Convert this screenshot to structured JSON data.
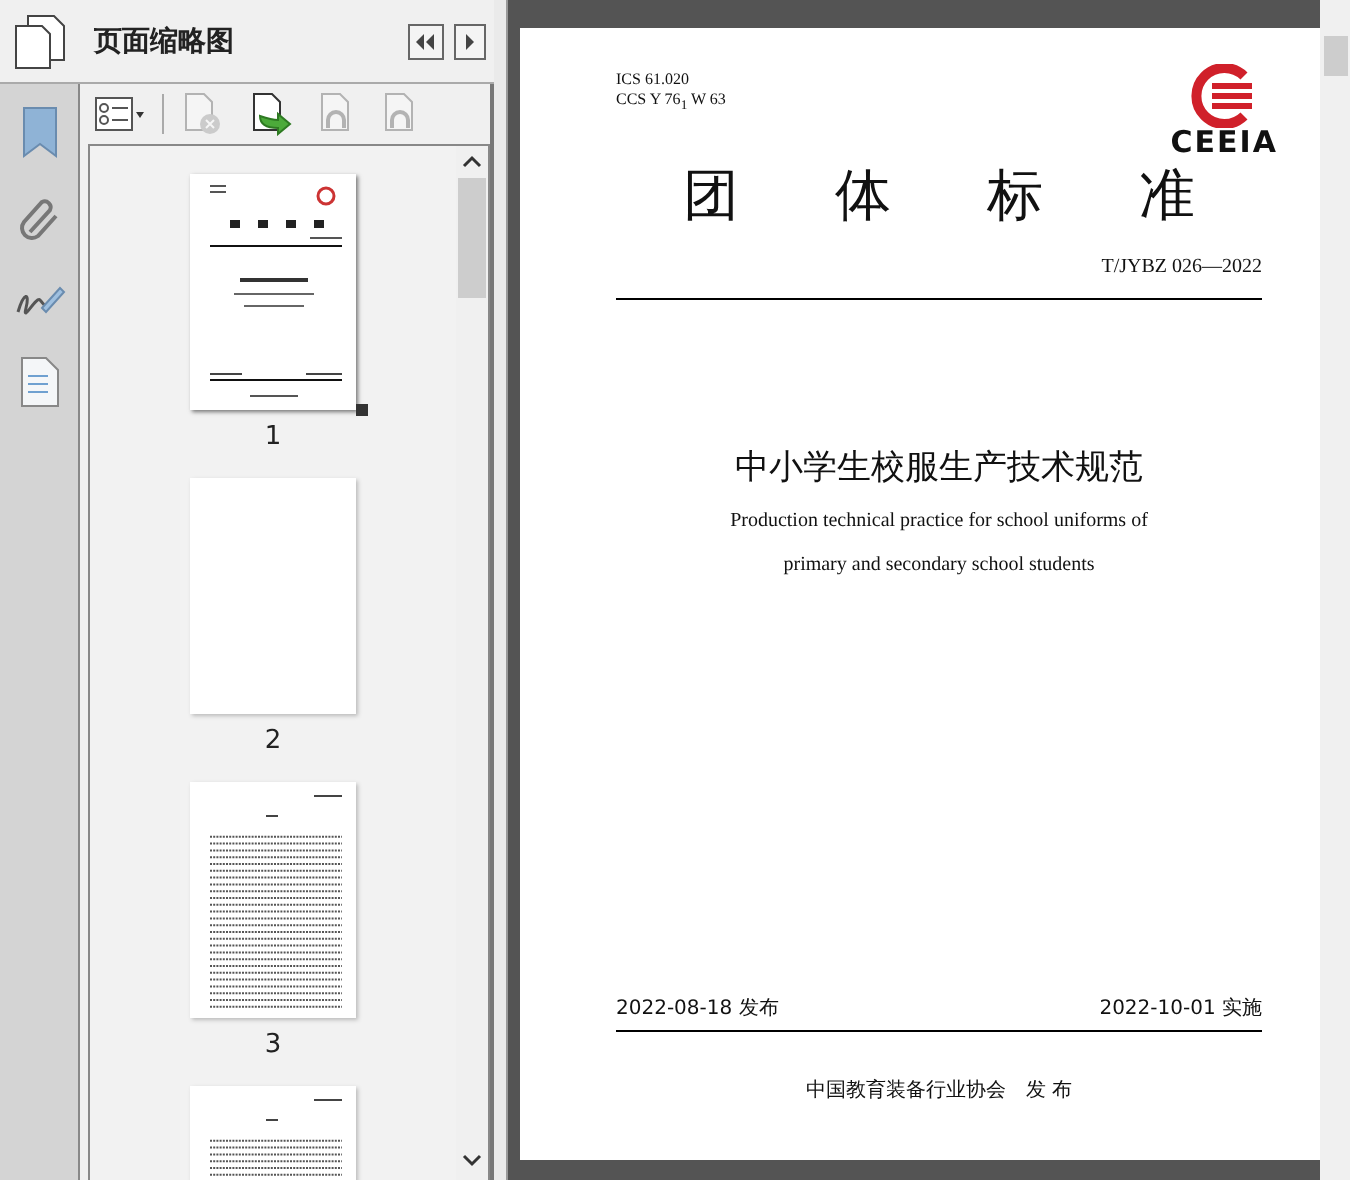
{
  "panel": {
    "title": "页面缩略图"
  },
  "toolbar": [
    {
      "kind": "options",
      "disabled": false
    },
    {
      "kind": "delete",
      "disabled": true
    },
    {
      "kind": "insert",
      "disabled": false
    },
    {
      "kind": "undo",
      "disabled": true
    },
    {
      "kind": "redo",
      "disabled": true
    }
  ],
  "thumbnails": [
    {
      "label": "1",
      "kind": "cover",
      "selected": true
    },
    {
      "label": "2",
      "kind": "blank",
      "selected": false
    },
    {
      "label": "3",
      "kind": "contents",
      "selected": false
    },
    {
      "kind": "contents",
      "selected": false
    }
  ],
  "document": {
    "ics": "ICS 61.020",
    "ccs": "CCS Y 76$_{1}$ W 63",
    "logo": "CEEIA",
    "heading": "团体标准",
    "code": "T/JYBZ 026—2022",
    "title_cn": "中小学生校服生产技术规范",
    "title_en": [
      "Production technical practice for school uniforms of",
      "primary and secondary school students"
    ],
    "issued": "2022-08-18 发布",
    "effective": "2022-10-01 实施",
    "publisher": "中国教育装备行业协会　发 布"
  }
}
